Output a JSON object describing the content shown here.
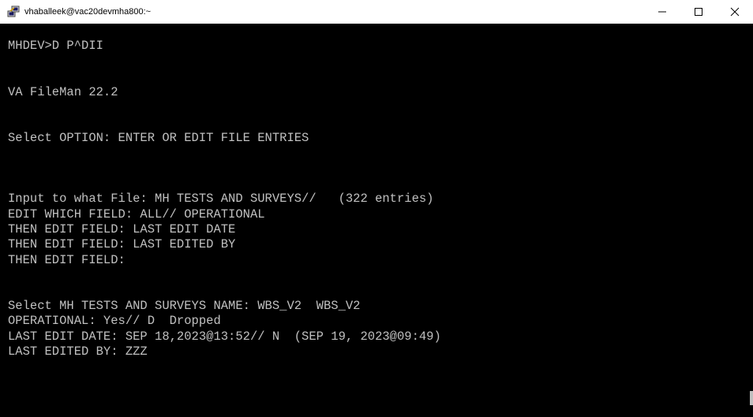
{
  "window": {
    "title": "vhaballeek@vac20devmha800:~",
    "minimize_glyph": "—",
    "maximize_glyph": "☐",
    "close_glyph": "✕",
    "icon": "putty-terminal-icon"
  },
  "terminal": {
    "lines": [
      "",
      "MHDEV>D P^DII",
      "",
      "",
      "VA FileMan 22.2",
      "",
      "",
      "Select OPTION: ENTER OR EDIT FILE ENTRIES",
      "",
      "",
      "",
      "Input to what File: MH TESTS AND SURVEYS//   (322 entries)",
      "EDIT WHICH FIELD: ALL// OPERATIONAL",
      "THEN EDIT FIELD: LAST EDIT DATE",
      "THEN EDIT FIELD: LAST EDITED BY",
      "THEN EDIT FIELD:",
      "",
      "",
      "Select MH TESTS AND SURVEYS NAME: WBS_V2  WBS_V2",
      "OPERATIONAL: Yes// D  Dropped",
      "LAST EDIT DATE: SEP 18,2023@13:52// N  (SEP 19, 2023@09:49)",
      "LAST EDITED BY: ZZZ"
    ]
  },
  "colors": {
    "background": "#000000",
    "foreground": "#c0c0c0",
    "titlebar": "#ffffff"
  }
}
